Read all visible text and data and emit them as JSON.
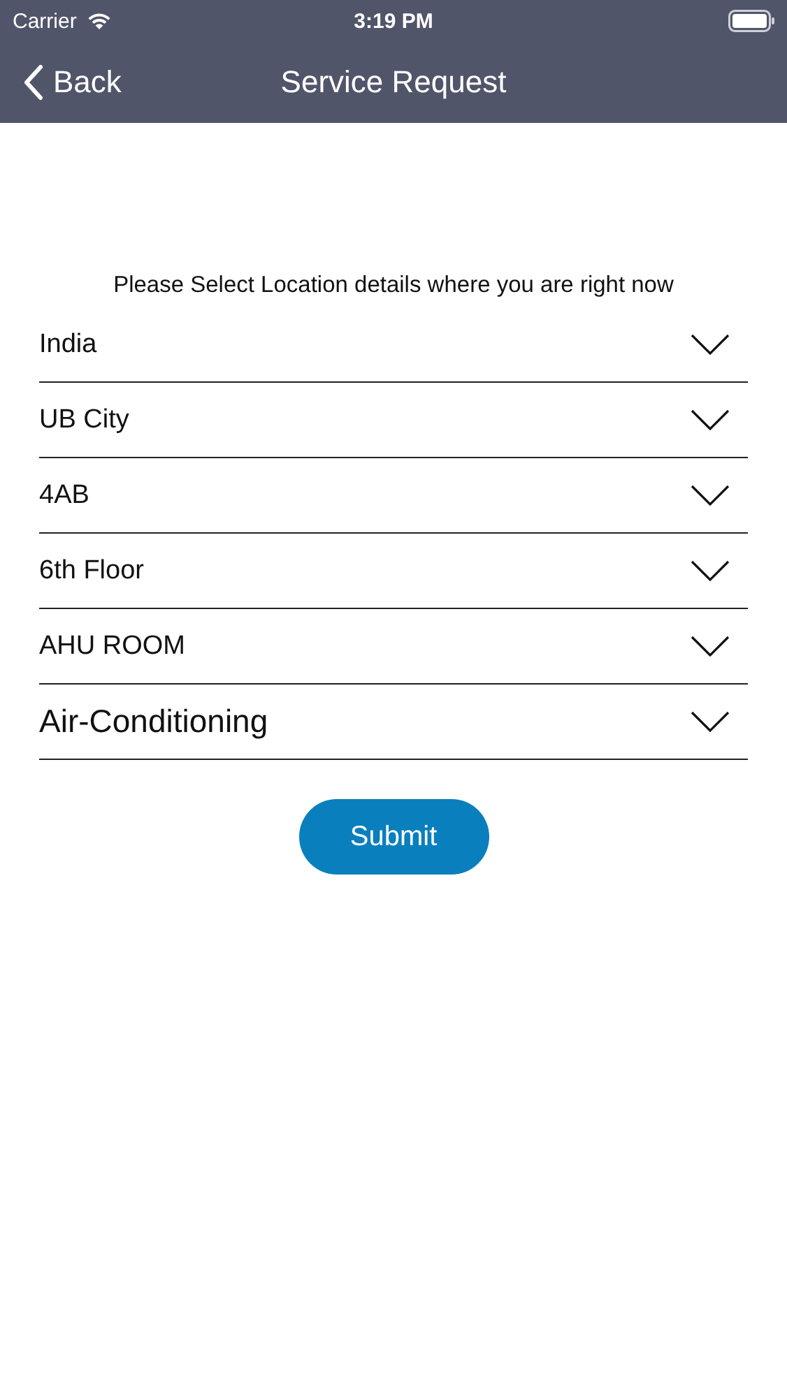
{
  "status_bar": {
    "carrier": "Carrier",
    "time": "3:19 PM"
  },
  "nav_bar": {
    "back": "Back",
    "title": "Service Request"
  },
  "prompt": "Please Select Location details where you are right now",
  "pickers": [
    {
      "value": "India",
      "large": false
    },
    {
      "value": "UB City",
      "large": false
    },
    {
      "value": "4AB",
      "large": false
    },
    {
      "value": "6th Floor",
      "large": false
    },
    {
      "value": "AHU ROOM",
      "large": false
    },
    {
      "value": "Air-Conditioning",
      "large": true
    }
  ],
  "buttons": [
    "Submit"
  ]
}
